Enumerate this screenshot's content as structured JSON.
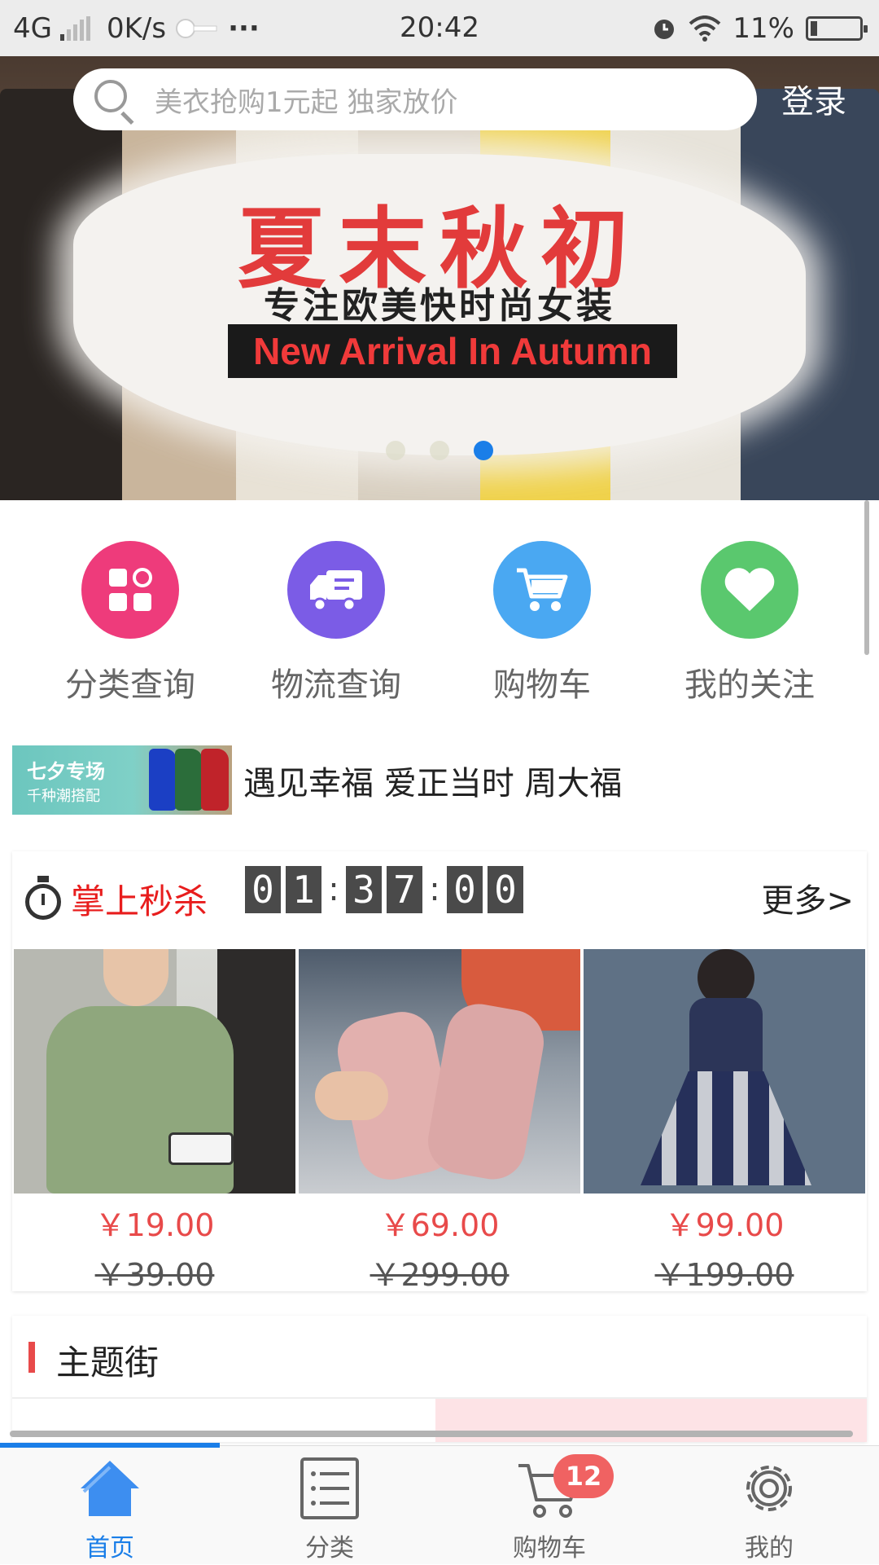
{
  "status_bar": {
    "network": "4G",
    "speed": "0K/s",
    "more": "···",
    "time": "20:42",
    "battery": "11%"
  },
  "header": {
    "search_placeholder": "美衣抢购1元起 独家放价",
    "login_label": "登录"
  },
  "banner": {
    "title": "夏末秋初",
    "subtitle": "专注欧美快时尚女装",
    "tagline": "New Arrival In Autumn",
    "slide_count": 3,
    "active_slide": 3
  },
  "quick_menu": [
    {
      "label": "分类查询",
      "icon": "category-grid-icon",
      "color": "#ee3b7b"
    },
    {
      "label": "物流查询",
      "icon": "delivery-truck-icon",
      "color": "#7b5ce6"
    },
    {
      "label": "购物车",
      "icon": "shopping-cart-icon",
      "color": "#4aa8f2"
    },
    {
      "label": "我的关注",
      "icon": "heart-icon",
      "color": "#5ac86e"
    }
  ],
  "promo": {
    "badge_line1": "七夕专场",
    "badge_line2": "千种潮搭配",
    "text": "遇见幸福 爱正当时 周大福"
  },
  "flash_sale": {
    "title": "掌上秒杀",
    "countdown": [
      "0",
      "1",
      "3",
      "7",
      "0",
      "0"
    ],
    "more_label": "更多>",
    "products": [
      {
        "name": "green-tshirt",
        "price": "￥19.00",
        "original_price": "￥39.00"
      },
      {
        "name": "pink-flats",
        "price": "￥69.00",
        "original_price": "￥299.00"
      },
      {
        "name": "striped-dress",
        "price": "￥99.00",
        "original_price": "￥199.00"
      }
    ]
  },
  "theme_street": {
    "title": "主题街"
  },
  "tab_bar": {
    "tabs": [
      {
        "label": "首页",
        "icon": "home-icon",
        "active": true
      },
      {
        "label": "分类",
        "icon": "list-icon",
        "active": false
      },
      {
        "label": "购物车",
        "icon": "cart-icon",
        "active": false
      },
      {
        "label": "我的",
        "icon": "settings-gear-icon",
        "active": false
      }
    ],
    "cart_badge": "12"
  },
  "colors": {
    "accent": "#1a7ee8",
    "price_red": "#e84a4a",
    "flash_red": "#e81d1d"
  }
}
